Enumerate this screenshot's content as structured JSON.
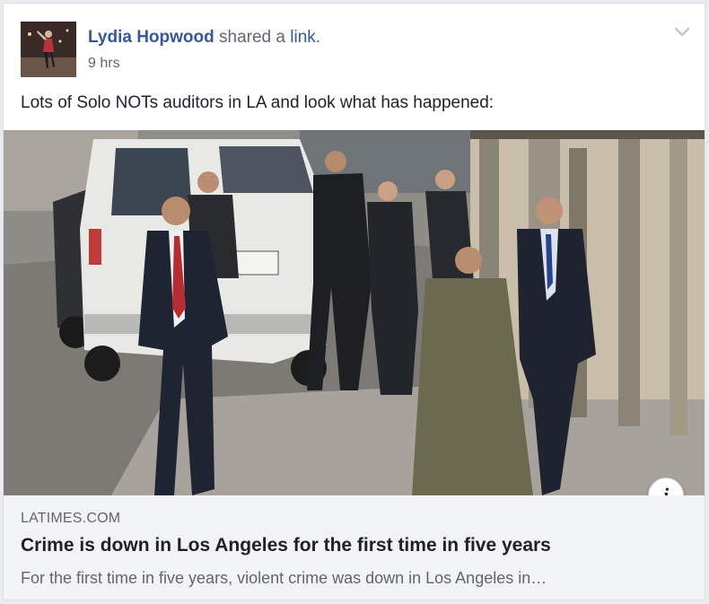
{
  "post": {
    "author": "Lydia Hopwood",
    "action_prefix": "shared a",
    "action_link": "link",
    "action_suffix": ".",
    "time": "9 hrs",
    "text": "Lots of Solo NOTs auditors in LA and look what has happened:"
  },
  "link_preview": {
    "domain": "LATIMES.COM",
    "title": "Crime is down in Los Angeles for the first time in five years",
    "description": "For the first time in five years, violent crime was down in Los Angeles in…",
    "info_icon_label": "i"
  },
  "icons": {
    "menu": "chevron-down-icon",
    "info": "info-icon"
  },
  "colors": {
    "link_blue": "#365899",
    "secondary_text": "#616770",
    "preview_bg": "#f2f3f5"
  }
}
